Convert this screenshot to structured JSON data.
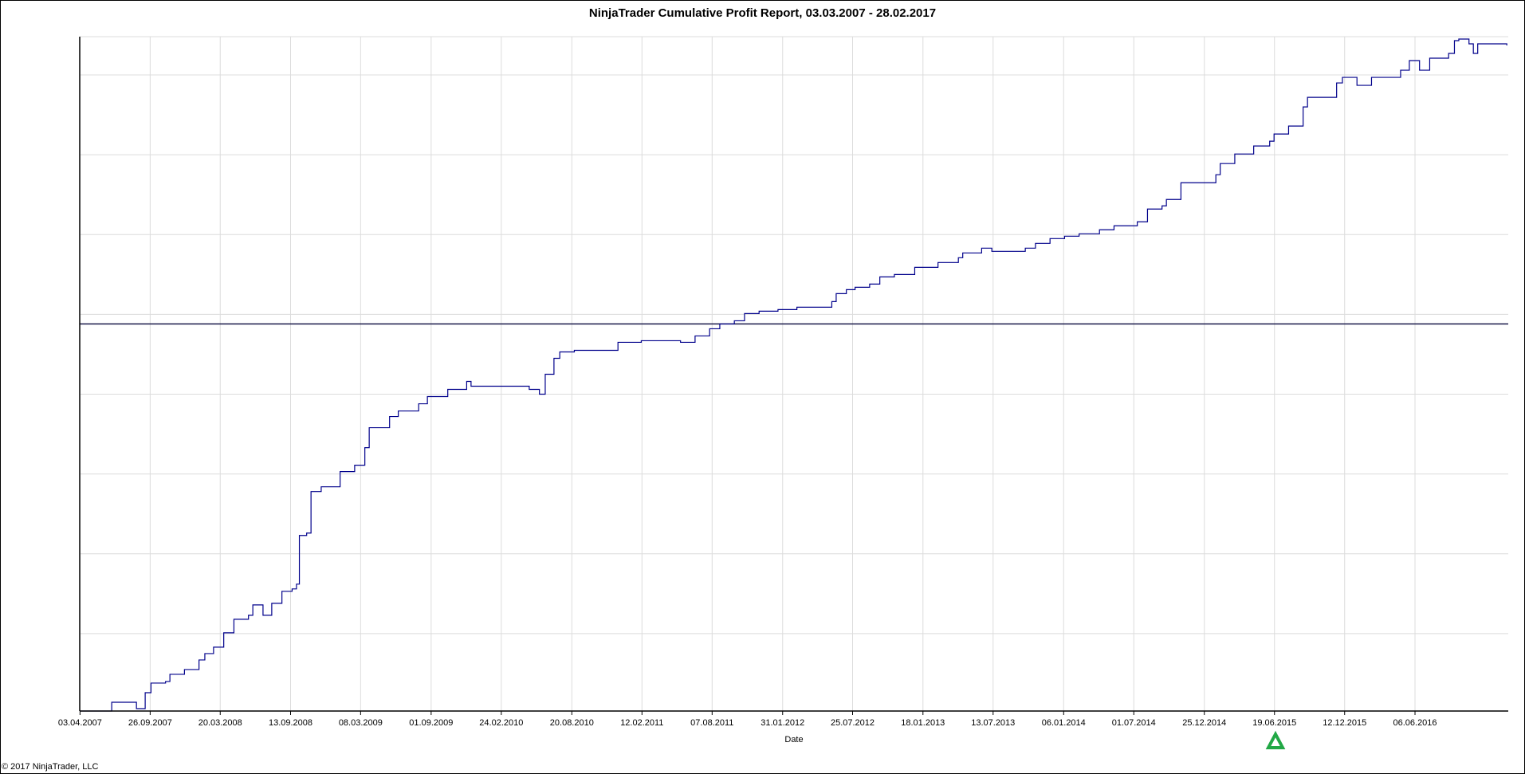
{
  "chart_data": {
    "type": "line",
    "title": "NinjaTrader Cumulative Profit Report, 03.03.2007 - 28.02.2017",
    "xlabel": "Date",
    "ylabel": "",
    "x_units": "decimal year",
    "y_units": "relative (y-axis tick labels not legible)",
    "xlim": [
      2007.25,
      2017.07
    ],
    "ylim": [
      -4.85,
      3.6
    ],
    "grid": true,
    "zero_line": 0,
    "x_tick_labels": [
      "03.04.2007",
      "26.09.2007",
      "20.03.2008",
      "13.09.2008",
      "08.03.2009",
      "01.09.2009",
      "24.02.2010",
      "20.08.2010",
      "12.02.2011",
      "07.08.2011",
      "31.01.2012",
      "25.07.2012",
      "18.01.2013",
      "13.07.2013",
      "06.01.2014",
      "01.07.2014",
      "25.12.2014",
      "19.06.2015",
      "12.12.2015",
      "06.06.2016"
    ],
    "series": [
      {
        "name": "Cumulative Profit",
        "color": "#00008b",
        "points": [
          [
            2007.25,
            -4.85
          ],
          [
            2007.44,
            -4.85
          ],
          [
            2007.47,
            -4.74
          ],
          [
            2007.6,
            -4.74
          ],
          [
            2007.64,
            -4.82
          ],
          [
            2007.7,
            -4.62
          ],
          [
            2007.74,
            -4.5
          ],
          [
            2007.84,
            -4.48
          ],
          [
            2007.87,
            -4.39
          ],
          [
            2007.97,
            -4.33
          ],
          [
            2008.07,
            -4.21
          ],
          [
            2008.11,
            -4.13
          ],
          [
            2008.17,
            -4.05
          ],
          [
            2008.24,
            -3.87
          ],
          [
            2008.31,
            -3.7
          ],
          [
            2008.41,
            -3.65
          ],
          [
            2008.44,
            -3.52
          ],
          [
            2008.51,
            -3.65
          ],
          [
            2008.57,
            -3.5
          ],
          [
            2008.64,
            -3.35
          ],
          [
            2008.71,
            -3.32
          ],
          [
            2008.74,
            -3.26
          ],
          [
            2008.76,
            -2.65
          ],
          [
            2008.81,
            -2.62
          ],
          [
            2008.84,
            -2.1
          ],
          [
            2008.91,
            -2.04
          ],
          [
            2009.01,
            -2.04
          ],
          [
            2009.04,
            -1.85
          ],
          [
            2009.14,
            -1.77
          ],
          [
            2009.21,
            -1.55
          ],
          [
            2009.24,
            -1.3
          ],
          [
            2009.38,
            -1.16
          ],
          [
            2009.44,
            -1.09
          ],
          [
            2009.58,
            -1.0
          ],
          [
            2009.64,
            -0.91
          ],
          [
            2009.78,
            -0.82
          ],
          [
            2009.91,
            -0.72
          ],
          [
            2009.94,
            -0.78
          ],
          [
            2010.14,
            -0.78
          ],
          [
            2010.34,
            -0.82
          ],
          [
            2010.41,
            -0.88
          ],
          [
            2010.45,
            -0.63
          ],
          [
            2010.51,
            -0.43
          ],
          [
            2010.55,
            -0.35
          ],
          [
            2010.65,
            -0.33
          ],
          [
            2010.88,
            -0.33
          ],
          [
            2010.95,
            -0.23
          ],
          [
            2011.11,
            -0.21
          ],
          [
            2011.31,
            -0.21
          ],
          [
            2011.38,
            -0.23
          ],
          [
            2011.48,
            -0.15
          ],
          [
            2011.58,
            -0.06
          ],
          [
            2011.65,
            0.0
          ],
          [
            2011.75,
            0.04
          ],
          [
            2011.82,
            0.13
          ],
          [
            2011.92,
            0.16
          ],
          [
            2012.05,
            0.18
          ],
          [
            2012.18,
            0.21
          ],
          [
            2012.35,
            0.21
          ],
          [
            2012.42,
            0.28
          ],
          [
            2012.45,
            0.38
          ],
          [
            2012.52,
            0.43
          ],
          [
            2012.58,
            0.46
          ],
          [
            2012.68,
            0.5
          ],
          [
            2012.75,
            0.59
          ],
          [
            2012.85,
            0.62
          ],
          [
            2012.99,
            0.71
          ],
          [
            2013.15,
            0.77
          ],
          [
            2013.29,
            0.83
          ],
          [
            2013.32,
            0.89
          ],
          [
            2013.45,
            0.95
          ],
          [
            2013.52,
            0.91
          ],
          [
            2013.65,
            0.91
          ],
          [
            2013.75,
            0.95
          ],
          [
            2013.82,
            1.01
          ],
          [
            2013.92,
            1.07
          ],
          [
            2014.02,
            1.1
          ],
          [
            2014.12,
            1.13
          ],
          [
            2014.26,
            1.18
          ],
          [
            2014.36,
            1.23
          ],
          [
            2014.52,
            1.28
          ],
          [
            2014.59,
            1.44
          ],
          [
            2014.69,
            1.48
          ],
          [
            2014.72,
            1.56
          ],
          [
            2014.82,
            1.77
          ],
          [
            2014.99,
            1.77
          ],
          [
            2015.06,
            1.87
          ],
          [
            2015.09,
            2.01
          ],
          [
            2015.19,
            2.13
          ],
          [
            2015.32,
            2.23
          ],
          [
            2015.43,
            2.29
          ],
          [
            2015.46,
            2.38
          ],
          [
            2015.56,
            2.48
          ],
          [
            2015.66,
            2.72
          ],
          [
            2015.69,
            2.84
          ],
          [
            2015.79,
            2.84
          ],
          [
            2015.89,
            3.02
          ],
          [
            2015.93,
            3.09
          ],
          [
            2016.03,
            2.99
          ],
          [
            2016.13,
            3.09
          ],
          [
            2016.33,
            3.18
          ],
          [
            2016.39,
            3.3
          ],
          [
            2016.46,
            3.18
          ],
          [
            2016.53,
            3.33
          ],
          [
            2016.66,
            3.39
          ],
          [
            2016.7,
            3.55
          ],
          [
            2016.73,
            3.57
          ],
          [
            2016.8,
            3.51
          ],
          [
            2016.83,
            3.39
          ],
          [
            2016.86,
            3.51
          ],
          [
            2017.06,
            3.49
          ]
        ]
      }
    ],
    "marker": {
      "type": "triangle-up",
      "x": 2015.47,
      "color": "#22a846"
    }
  },
  "footer": {
    "copyright": "© 2017 NinjaTrader, LLC"
  }
}
